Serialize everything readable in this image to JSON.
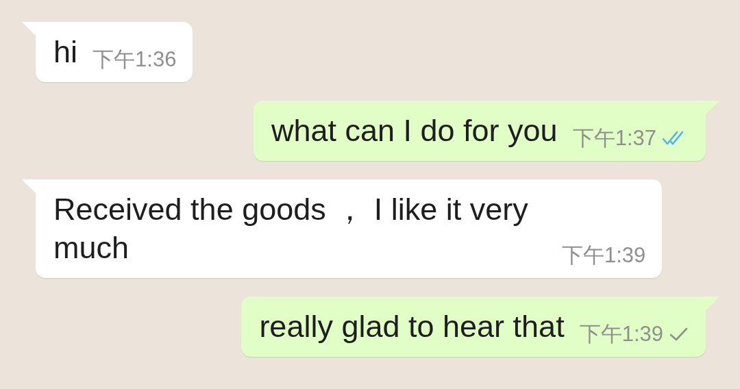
{
  "messages": [
    {
      "kind": "incoming",
      "text": "hi",
      "time": "下午1:36"
    },
    {
      "kind": "outgoing",
      "text": "what can I do for you",
      "time": "下午1:37",
      "read": true
    },
    {
      "kind": "incoming",
      "text": "Received the goods ， I like it very much",
      "time": "下午1:39"
    },
    {
      "kind": "outgoing",
      "text": "really glad to hear that",
      "time": "下午1:39",
      "read": false
    }
  ]
}
